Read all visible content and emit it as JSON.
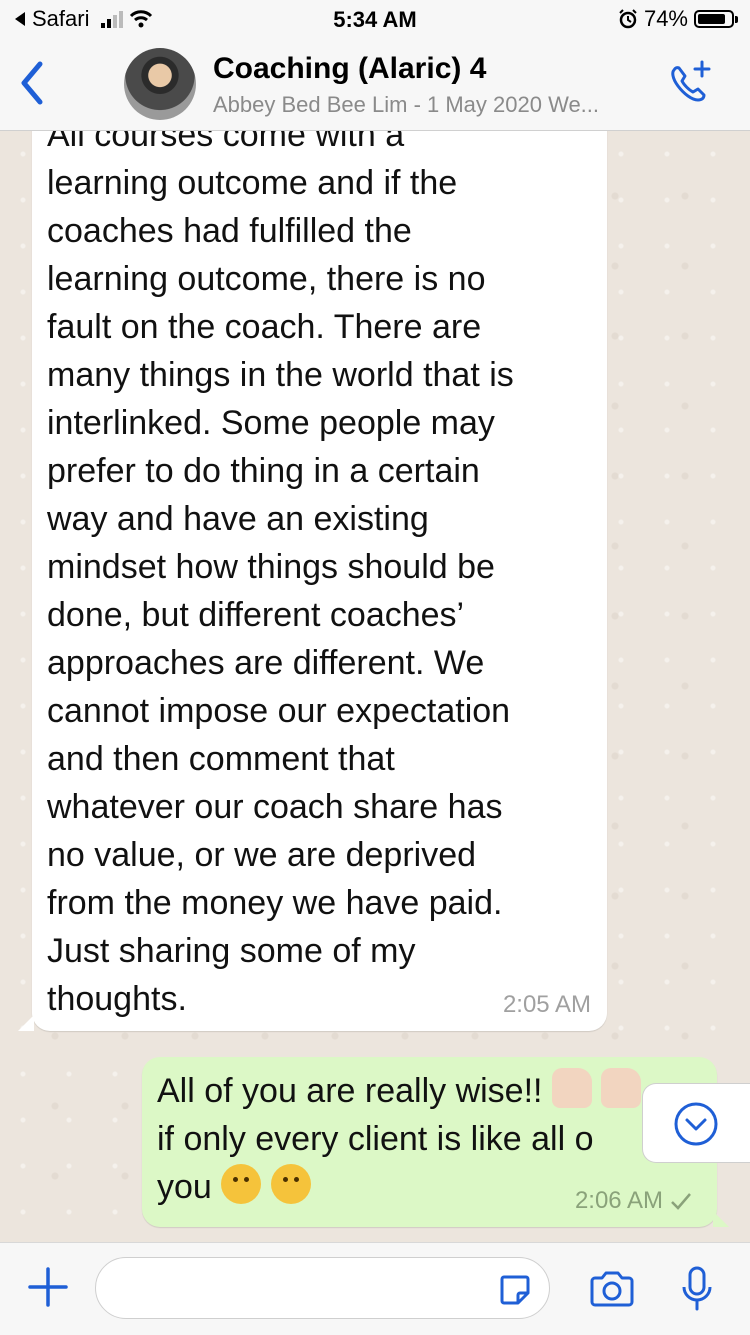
{
  "status_bar": {
    "back_app": "Safari",
    "time": "5:34 AM",
    "battery": "74%"
  },
  "header": {
    "title": "Coaching (Alaric) 4",
    "subtitle": "Abbey Bed Bee Lim - 1 May 2020 We..."
  },
  "messages": [
    {
      "direction": "incoming",
      "text": "All courses come with a\nlearning outcome and if the\ncoaches had fulfilled the\nlearning outcome, there is no\nfault on the coach. There are\nmany things in the world that is\ninterlinked. Some people may\nprefer to do thing in a certain\nway and have an existing\nmindset how things should be\ndone, but different coaches’\napproaches are different. We\ncannot impose our expectation\nand then comment that\nwhatever our coach share has\nno value, or we are deprived\nfrom the money we have paid.\nJust sharing some of my\nthoughts.",
      "time": "2:05 AM"
    },
    {
      "direction": "outgoing",
      "line1": "All of you are really wise!!",
      "line2": "if only every client is like all o",
      "line3": "you",
      "time": "2:06 AM",
      "status_icon": "single-check-icon"
    }
  ],
  "composer": {
    "placeholder": ""
  },
  "colors": {
    "accent": "#1f5fd6",
    "incoming_bubble": "#ffffff",
    "outgoing_bubble": "#dcf8c6",
    "chat_background": "#ece5dd"
  }
}
